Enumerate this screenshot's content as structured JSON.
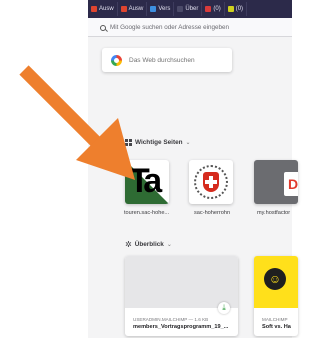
{
  "tabs": [
    {
      "label": "Ausw",
      "color": "#e0452f"
    },
    {
      "label": "Ausw",
      "color": "#e0452f"
    },
    {
      "label": "Vers",
      "color": "#3d8fe0"
    },
    {
      "label": "Über",
      "color": "#4b4a68"
    },
    {
      "label": "(0) ",
      "color": "#d83b3b"
    },
    {
      "label": "(0)",
      "color": "#cfd11e"
    }
  ],
  "urlbar": {
    "placeholder": "Mit Google suchen oder Adresse eingeben"
  },
  "search": {
    "placeholder": "Das Web durchsuchen"
  },
  "top_sites": {
    "heading": "Wichtige Seiten",
    "tiles": [
      {
        "label": "touren.sac-hohe...",
        "logo_text": "Ta"
      },
      {
        "label": "sac-hoherrohn"
      },
      {
        "label": "my.hostfactor"
      }
    ]
  },
  "highlights": {
    "heading": "Überblick",
    "cards": [
      {
        "meta": "USERADMIN.MAILCHIMP — 1.6 KB",
        "title": "members_Vortragsprogramm_19_..."
      },
      {
        "meta": "MAILCHIMP",
        "title": "Soft vs. Ha"
      }
    ]
  },
  "colors": {
    "arrow": "#ee7f2d",
    "tabbar": "#2c2a4a"
  }
}
